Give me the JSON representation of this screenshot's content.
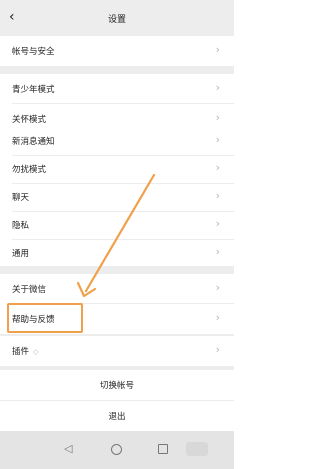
{
  "header": {
    "title": "设置",
    "back_icon": "chevron-left-icon"
  },
  "groups": [
    {
      "items": [
        {
          "label": "帐号与安全"
        }
      ]
    },
    {
      "items": [
        {
          "label": "青少年模式"
        },
        {
          "label": "关怀模式"
        }
      ]
    },
    {
      "items": [
        {
          "label": "新消息通知"
        },
        {
          "label": "勿扰模式"
        },
        {
          "label": "聊天"
        },
        {
          "label": "隐私"
        },
        {
          "label": "通用"
        }
      ]
    },
    {
      "items": [
        {
          "label": "关于微信"
        },
        {
          "label": "帮助与反馈"
        }
      ]
    },
    {
      "items": [
        {
          "label": "插件",
          "badge": "◇"
        }
      ]
    }
  ],
  "actions": {
    "switch_account": "切换帐号",
    "logout": "退出"
  },
  "chevron": "›",
  "navbar": {
    "icons": [
      "back-triangle-icon",
      "home-circle-icon",
      "recents-square-icon"
    ]
  },
  "annotation": {
    "highlight_color": "#f0a04a",
    "target": "帮助与反馈"
  }
}
